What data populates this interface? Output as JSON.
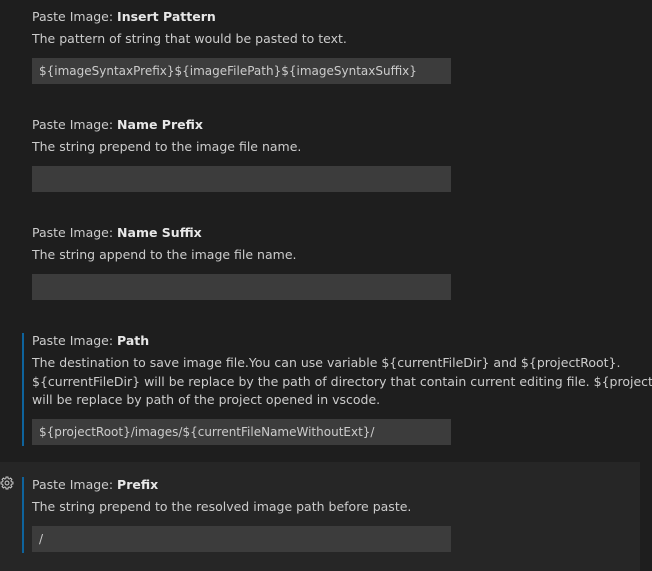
{
  "settings": [
    {
      "category": "Paste Image: ",
      "key": "Insert Pattern",
      "description": "The pattern of string that would be pasted to text.",
      "value": "${imageSyntaxPrefix}${imageFilePath}${imageSyntaxSuffix}"
    },
    {
      "category": "Paste Image: ",
      "key": "Name Prefix",
      "description": "The string prepend to the image file name.",
      "value": ""
    },
    {
      "category": "Paste Image: ",
      "key": "Name Suffix",
      "description": "The string append to the image file name.",
      "value": ""
    },
    {
      "category": "Paste Image: ",
      "key": "Path",
      "description_lines": [
        "The destination to save image file.You can use variable ${currentFileDir} and ${projectRoot}.",
        "${currentFileDir} will be replace by the path of directory that contain current editing file. ${projectRoot}",
        "will be replace by path of the project opened in vscode."
      ],
      "value": "${projectRoot}/images/${currentFileNameWithoutExt}/"
    },
    {
      "category": "Paste Image: ",
      "key": "Prefix",
      "description": "The string prepend to the resolved image path before paste.",
      "value": "/"
    }
  ],
  "icons": {
    "gear": "gear-icon"
  },
  "colors": {
    "background": "#1e1e1e",
    "focused_background": "#262626",
    "input_background": "#3c3c3c",
    "focus_bar": "#0e639c",
    "text": "#cccccc"
  }
}
